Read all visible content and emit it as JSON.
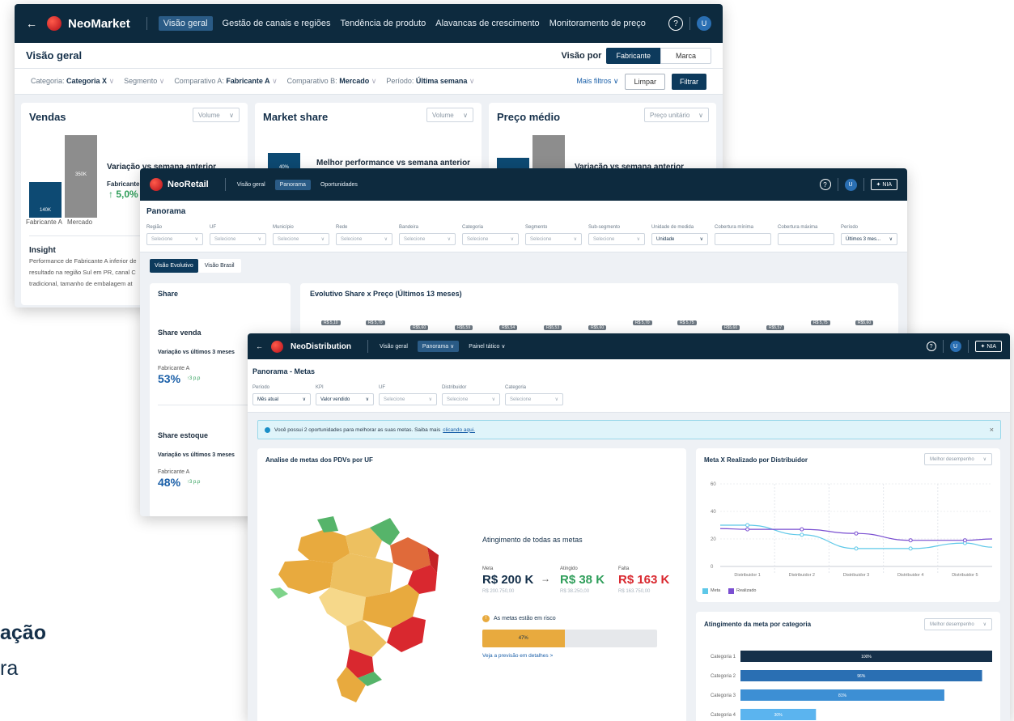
{
  "market": {
    "brand": "NeoMarket",
    "nav": [
      "Visão geral",
      "Gestão de canais e regiões",
      "Tendência de produto",
      "Alavancas de crescimento",
      "Monitoramento de preço"
    ],
    "avatar": "U",
    "help_icon": "?",
    "page_title": "Visão geral",
    "view_by_label": "Visão por",
    "view_by_options": [
      "Fabricante",
      "Marca"
    ],
    "filters": [
      {
        "label": "Categoria:",
        "value": "Categoria X"
      },
      {
        "label": "Segmento",
        "value": ""
      },
      {
        "label": "Comparativo A:",
        "value": "Fabricante A"
      },
      {
        "label": "Comparativo B:",
        "value": "Mercado"
      },
      {
        "label": "Período:",
        "value": "Última semana"
      }
    ],
    "more_filters": "Mais filtros",
    "clear": "Limpar",
    "filter": "Filtrar",
    "cards": {
      "vendas": {
        "title": "Vendas",
        "dropdown": "Volume",
        "bars": [
          {
            "label": "140K",
            "value": 140,
            "cat": "Fabricante A"
          },
          {
            "label": "350K",
            "value": 350,
            "cat": "Mercado"
          }
        ],
        "variation_title": "Variação vs semana anterior",
        "variation_sub": "Fabricante",
        "variation_value": "↑ 5,0%"
      },
      "share": {
        "title": "Market share",
        "dropdown": "Volume",
        "bar_label": "40%",
        "perf_title": "Melhor performance vs semana anterior"
      },
      "preco": {
        "title": "Preço médio",
        "dropdown": "Preço unitário",
        "variation_title": "Variação vs semana anterior"
      }
    },
    "insight_title": "Insight",
    "insight_lines": [
      "Performance de Fabricante A inferior de",
      "resultado na região Sul em PR, canal C",
      "tradicional, tamanho de embalagem at"
    ],
    "side_title_1": "ação",
    "side_title_2": "ra"
  },
  "retail": {
    "brand": "NeoRetail",
    "nav": [
      "Visão geral",
      "Panorama",
      "Oportunidades"
    ],
    "avatar": "U",
    "help_icon": "?",
    "nia": "✦ NIA",
    "page_title": "Panorama",
    "filters": [
      {
        "label": "Região",
        "value": "Selecione"
      },
      {
        "label": "UF",
        "value": "Selecione"
      },
      {
        "label": "Município",
        "value": "Selecione"
      },
      {
        "label": "Rede",
        "value": "Selecione"
      },
      {
        "label": "Bandeira",
        "value": "Selecione"
      },
      {
        "label": "Categoria",
        "value": "Selecione"
      },
      {
        "label": "Segmento",
        "value": "Selecione"
      },
      {
        "label": "Sub-segmento",
        "value": "Selecione"
      },
      {
        "label": "Unidade de medida",
        "value": "Unidade"
      },
      {
        "label": "Cobertura mínima",
        "value": ""
      },
      {
        "label": "Cobertura máxima",
        "value": ""
      },
      {
        "label": "Período",
        "value": "Últimos 3 mes..."
      }
    ],
    "tabs": [
      "Visão Evolutivo",
      "Visão Brasil"
    ],
    "share_title": "Share",
    "share_venda": {
      "title": "Share venda",
      "sub": "Variação vs últimos 3 meses",
      "maker": "Fabricante A",
      "value": "53%",
      "delta": "↑3 p.p"
    },
    "share_estoque": {
      "title": "Share estoque",
      "sub": "Variação vs últimos 3 meses",
      "maker": "Fabricante A",
      "value": "48%",
      "delta": "↑3 p.p"
    },
    "evo_title": "Evolutivo Share x Preço (Últimos 13 meses)",
    "price_tags": [
      "R$ 5,10",
      "R$ 5,70",
      "R$5,60",
      "R$5,59",
      "R$5,54",
      "R$5,53",
      "R$5,60",
      "R$ 5,70",
      "R$ 5,75",
      "R$5,60",
      "R$5,57",
      "R$ 5,75",
      "R$5,60"
    ]
  },
  "dist": {
    "brand": "NeoDistribution",
    "nav": [
      "Visão geral",
      "Panorama ∨",
      "Painel tático ∨"
    ],
    "avatar": "U",
    "help_icon": "?",
    "nia": "✦ NIA",
    "page_title": "Panorama - Metas",
    "filters": [
      {
        "label": "Período",
        "value": "Mês atual"
      },
      {
        "label": "KPI",
        "value": "Valor vendido"
      },
      {
        "label": "UF",
        "value": "Selecione"
      },
      {
        "label": "Distribuidor",
        "value": "Selecione"
      },
      {
        "label": "Categoria",
        "value": "Selecione"
      }
    ],
    "banner_text": "Você possui 2 oportunidades para melhorar as suas metas. Saiba mais",
    "banner_link": "clicando aqui.",
    "banner_close": "×",
    "map_card_title": "Analise de metas dos PDVs por UF",
    "goals_title": "Atingimento de todas as metas",
    "meta": {
      "label": "Meta",
      "value": "R$ 200 K",
      "sub": "R$ 200.750,00"
    },
    "atingido": {
      "label": "Atingido",
      "value": "R$ 38 K",
      "sub": "R$ 38.250,00"
    },
    "falta": {
      "label": "Falta",
      "value": "R$ 163 K",
      "sub": "R$ 163.750,00"
    },
    "risk_text": "As metas estão em risco",
    "progress": {
      "label": "47%",
      "value": 0.47
    },
    "forecast_link": "Veja a previsão em detalhes  >",
    "line_card": {
      "title": "Meta X Realizado por Distribuidor",
      "dropdown": "Melhor desempenho",
      "legend": [
        "Meta",
        "Realizado"
      ],
      "colors": {
        "meta": "#5ec8e8",
        "realizado": "#7a4fd1"
      }
    },
    "bar_card": {
      "title": "Atingimento da meta por categoria",
      "dropdown": "Melhor desempenho"
    },
    "colors": {
      "green": "#2f9e5a",
      "red": "#d9282f",
      "blue": "#15304a",
      "amber": "#e8aa3e"
    }
  },
  "chart_data": [
    {
      "type": "line",
      "categories": [
        "Distribuidor 1",
        "Distribuidor 2",
        "Distribuidor 3",
        "Distribuidor 4",
        "Distribuidor 5"
      ],
      "series": [
        {
          "name": "Meta",
          "values": [
            30,
            23,
            13,
            13,
            17
          ]
        },
        {
          "name": "Realizado",
          "values": [
            27,
            27,
            24,
            19,
            19
          ]
        }
      ],
      "ylim": [
        0,
        60
      ],
      "yticks": [
        "0",
        "20",
        "40",
        "60"
      ],
      "grid": true,
      "legend": "bottom-left"
    },
    {
      "type": "bar",
      "orientation": "horizontal",
      "categories": [
        "Categoria 1",
        "Categoria 2",
        "Categoria 3",
        "Categoria 4"
      ],
      "values": [
        100,
        96,
        81,
        30
      ],
      "labels": [
        "100%",
        "96%",
        "81%",
        "30%"
      ]
    }
  ]
}
